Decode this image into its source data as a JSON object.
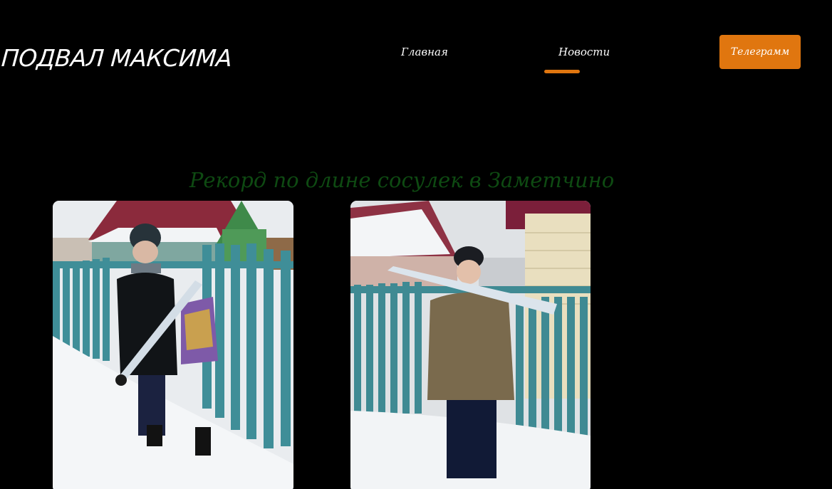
{
  "header": {
    "logo_text": "ПОДВАЛ МАКСИМА",
    "nav": {
      "home_label": "Главная",
      "news_label": "Новости",
      "active_tab": "Новости"
    },
    "telegram_button_label": "Телеграмм"
  },
  "article": {
    "title": "Рекорд по длине сосулек в Заметчино",
    "photos": [
      {
        "content": "boy in black jacket holding a long icicle by a wooden fence in snow"
      },
      {
        "content": "person in olive jacket holding a long icicle to mouth by a fence"
      }
    ]
  },
  "colors": {
    "background": "#000000",
    "accent": "#e0760f",
    "title_green": "#0e4a12",
    "text": "#ffffff"
  }
}
